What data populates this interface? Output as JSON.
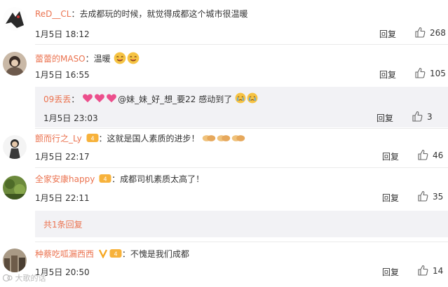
{
  "comments": [
    {
      "user": "ReD__CL",
      "text": "去成都玩的时候，就觉得成都这个城市很温暖",
      "time": "1月5日 18:12",
      "reply": "回复",
      "likes": "268"
    },
    {
      "user": "蕾蕾的MASO",
      "text": "温暖",
      "time": "1月5日 16:55",
      "reply": "回复",
      "likes": "105"
    },
    {
      "user": "09丢丢",
      "text": "@妹_妹_好_想_要22 感动到了",
      "time": "1月5日 23:03",
      "reply": "回复",
      "likes": "3"
    },
    {
      "user": "颤而行之_Ly",
      "text": "这就是国人素质的进步！",
      "time": "1月5日 22:17",
      "reply": "回复",
      "likes": "46"
    },
    {
      "user": "全家安康happy",
      "text": "成都司机素质太高了！",
      "time": "1月5日 22:11",
      "reply": "回复",
      "likes": "35"
    },
    {
      "user": "种蔡吃呱漏西西",
      "text": "不愧是我们成都",
      "time": "1月5日 20:50",
      "reply": "回复",
      "likes": "14"
    }
  ],
  "more_replies": "共1条回复",
  "watermark": "大歌的话",
  "colors": {
    "username": "#eb7350",
    "subbox_bg": "#f2f2f5",
    "divider": "#eaeaea"
  }
}
